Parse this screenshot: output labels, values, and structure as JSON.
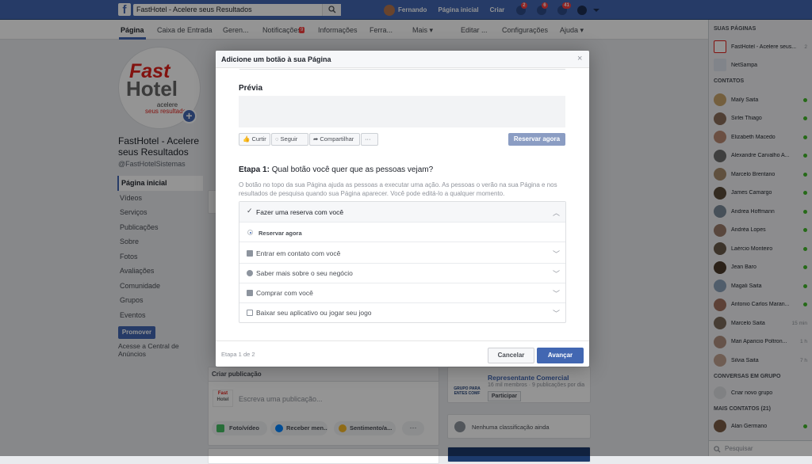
{
  "topbar": {
    "search_value": "FastHotel - Acelere seus Resultados",
    "user_name": "Fernando",
    "home_label": "Página inicial",
    "create_label": "Criar",
    "friend_requests_badge": "2",
    "messages_badge": "6",
    "notifications_badge": "41"
  },
  "page_tabs": {
    "tabs": [
      "Página",
      "Caixa de Entrada",
      "Geren...",
      "Notificações",
      "Informações",
      "Ferra...",
      "Mais ▾",
      "Editar ...",
      "Configurações",
      "Ajuda ▾"
    ],
    "notifications_badge": "9"
  },
  "page": {
    "logo_top": "Fast",
    "logo_bottom": "Hotel",
    "logo_tagline_1": "acelere",
    "logo_tagline_2": "seus resultados",
    "name": "FastHotel - Acelere seus Resultados",
    "handle": "@FastHotelSistemas",
    "nav": [
      "Página inicial",
      "Vídeos",
      "Serviços",
      "Publicações",
      "Sobre",
      "Fotos",
      "Avaliações",
      "Comunidade",
      "Grupos",
      "Eventos"
    ],
    "promote_label": "Promover",
    "access_central": "Acesse a Central de Anúncios"
  },
  "composer": {
    "header": "Criar publicação",
    "placeholder": "Escreva uma publicação...",
    "actions": [
      "Foto/vídeo",
      "Receber men...",
      "Sentimento/a..."
    ],
    "more": "···"
  },
  "side_cards": {
    "group_title": "Representante Comercial",
    "group_meta": "16 mil membros · 9 publicações por dia",
    "group_join": "Participar",
    "group_logo_text": "GRUPO PARA ENTES COMF",
    "rating_text": "Nenhuma classificação ainda"
  },
  "right_sidebar": {
    "pages_header": "SUAS PÁGINAS",
    "pages": [
      {
        "name": "FastHotel - Acelere seus...",
        "count": "2"
      },
      {
        "name": "NetSampa",
        "count": ""
      }
    ],
    "contacts_header": "CONTATOS",
    "contacts": [
      {
        "name": "Maily Saita",
        "time": ""
      },
      {
        "name": "Sirlei Thiago",
        "time": ""
      },
      {
        "name": "Elizabeth Macedo",
        "time": ""
      },
      {
        "name": "Alexandre Carvalho A...",
        "time": ""
      },
      {
        "name": "Marcelo Brentano",
        "time": ""
      },
      {
        "name": "James Camargo",
        "time": ""
      },
      {
        "name": "Andrea Hoffmann",
        "time": ""
      },
      {
        "name": "Andréa Lopes",
        "time": ""
      },
      {
        "name": "Laércio Monteiro",
        "time": ""
      },
      {
        "name": "Jean Baro",
        "time": ""
      },
      {
        "name": "Magali Saita",
        "time": ""
      },
      {
        "name": "Antonio Carlos Maran...",
        "time": ""
      },
      {
        "name": "Marcelo Saita",
        "time": "15 min"
      },
      {
        "name": "Mari Aparicio Poltron...",
        "time": "1 h"
      },
      {
        "name": "Silvia Saita",
        "time": "7 h"
      }
    ],
    "group_conv_header": "CONVERSAS EM GRUPO",
    "new_group": "Criar novo grupo",
    "more_contacts_header": "MAIS CONTATOS (21)",
    "more_contacts": [
      {
        "name": "Alan Germano"
      }
    ],
    "search_placeholder": "Pesquisar"
  },
  "dialog": {
    "title": "Adicione um botão à sua Página",
    "close": "×",
    "preview_label": "Prévia",
    "preview_buttons": [
      "Curtir",
      "Seguir",
      "Compartilhar",
      "···"
    ],
    "preview_cta": "Reservar agora",
    "step_label": "Etapa 1:",
    "step_question": "Qual botão você quer que as pessoas vejam?",
    "step_description": "O botão no topo da sua Página ajuda as pessoas a executar uma ação. As pessoas o verão na sua Página e nos resultados de pesquisa quando sua Página aparecer. Você pode editá-lo a qualquer momento.",
    "selected_option": "Fazer uma reserva com você",
    "selected_sub_option": "Reservar agora",
    "options": [
      "Entrar em contato com você",
      "Saber mais sobre o seu negócio",
      "Comprar com você",
      "Baixar seu aplicativo ou jogar seu jogo"
    ],
    "step_indicator": "Etapa 1 de 2",
    "cancel_label": "Cancelar",
    "next_label": "Avançar"
  },
  "colors": {
    "brand_blue": "#4267b2",
    "online_green": "#42b72a",
    "badge_red": "#fa3e3e"
  }
}
